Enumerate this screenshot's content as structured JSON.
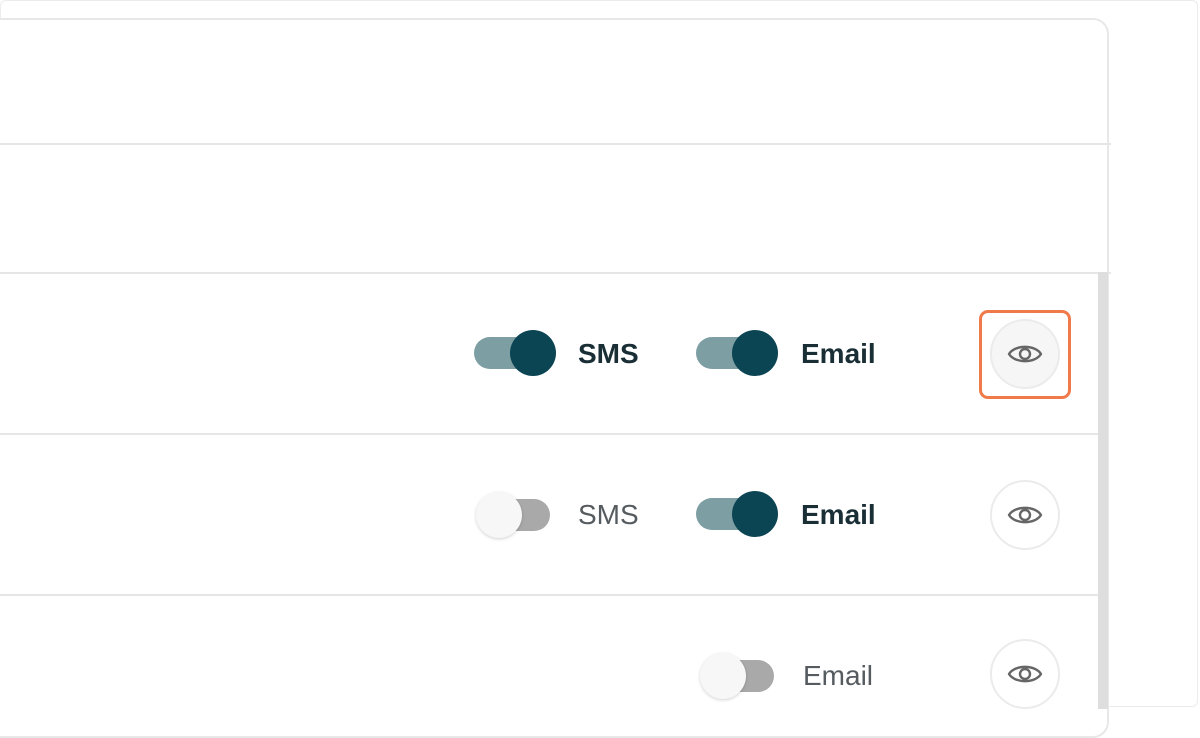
{
  "rows": [
    {
      "sms": {
        "label": "SMS",
        "enabled": true
      },
      "email": {
        "label": "Email",
        "enabled": true
      },
      "view_highlighted": true
    },
    {
      "sms": {
        "label": "SMS",
        "enabled": false
      },
      "email": {
        "label": "Email",
        "enabled": true
      },
      "view_highlighted": false
    },
    {
      "email": {
        "label": "Email",
        "enabled": false
      },
      "view_highlighted": false
    }
  ],
  "colors": {
    "toggle_on_knob": "#0b4453",
    "toggle_on_track": "#7d9ea3",
    "toggle_off_track": "#a9a9a9",
    "highlight": "#f07a4a"
  },
  "icons": {
    "view": "eye-icon"
  }
}
